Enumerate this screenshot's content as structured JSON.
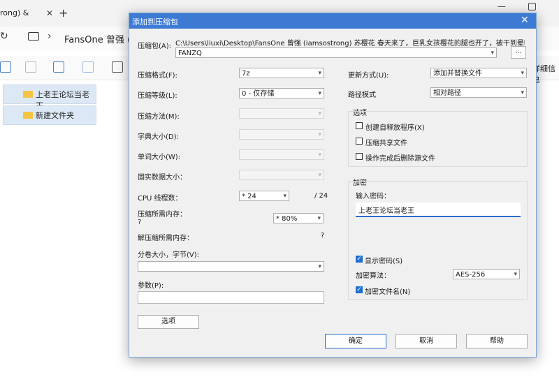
{
  "explorer": {
    "tab_title": "rong) &",
    "tab_close": "✕",
    "new_tab": "+",
    "minimize": "—",
    "refresh": "↻",
    "chevron": "›",
    "path": "FansOne 曾强 (ia",
    "details": "详细信息",
    "items": [
      "上老王论坛当老王",
      "新建文件夹"
    ]
  },
  "dialog": {
    "title": "添加到压缩包",
    "close": "✕",
    "archive_label": "压缩包(A):",
    "archive_path": "C:\\Users\\liuxi\\Desktop\\FansOne 曾强 (iamsostrong) 苏樱花 春天来了，巨乳女孩樱花的腿也开了，被干到晕呼呼\\",
    "archive_name": "FANZQ",
    "browse": "...",
    "left": [
      {
        "label": "压缩格式(F):",
        "value": "7z"
      },
      {
        "label": "压缩等级(L):",
        "value": "0 - 仅存储"
      },
      {
        "label": "压缩方法(M):",
        "value": ""
      },
      {
        "label": "字典大小(D):",
        "value": ""
      },
      {
        "label": "单词大小(W):",
        "value": ""
      },
      {
        "label": "固实数据大小：",
        "value": ""
      }
    ],
    "cpu_label": "CPU 线程数：",
    "cpu_value": "* 24",
    "cpu_total": "/ 24",
    "mem_label": "压缩所需内存：",
    "mem_q": "?",
    "mem_value": "* 80%",
    "decomp_label": "解压缩所需内存：",
    "decomp_value": "?",
    "volume_label": "分卷大小，字节(V):",
    "params_label": "参数(P):",
    "options_button": "选项",
    "update_label": "更新方式(U):",
    "update_value": "添加并替换文件",
    "path_label": "路径模式",
    "path_value": "相对路径",
    "options_group": "选项",
    "checkboxes": [
      "创建自释放程序(X)",
      "压缩共享文件",
      "操作完成后删除源文件"
    ],
    "encrypt_group": "加密",
    "password_label": "输入密码：",
    "password_value": "上老王论坛当老王",
    "show_password": "显示密码(S)",
    "method_label": "加密算法：",
    "method_value": "AES-256",
    "encrypt_names": "加密文件名(N)",
    "check_mark": "✓",
    "ok": "确定",
    "cancel": "取消",
    "help": "帮助"
  }
}
